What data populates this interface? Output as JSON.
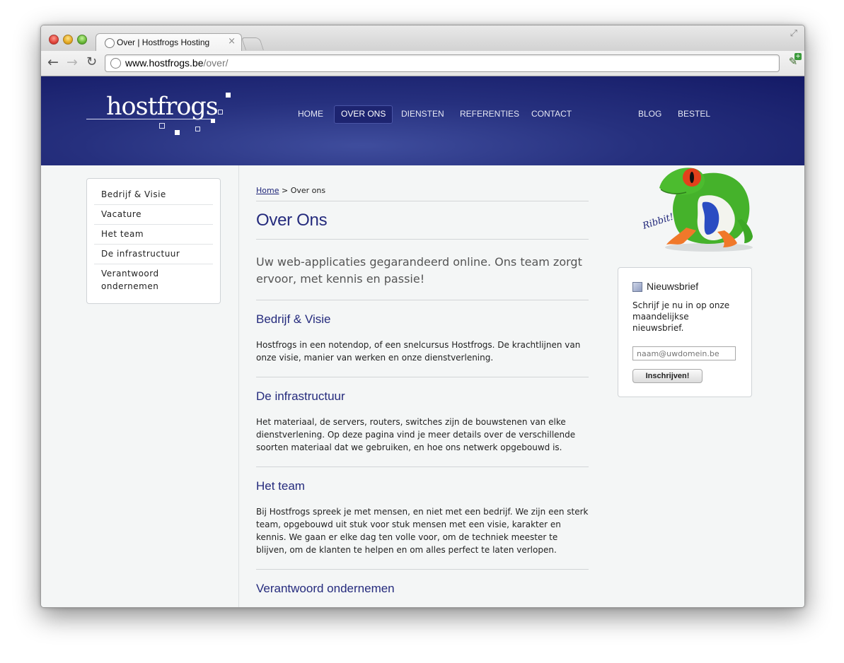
{
  "browser": {
    "tab_title": "Over | Hostfrogs Hosting",
    "tab_close": "×",
    "url_host": "www.hostfrogs.be",
    "url_path": "/over/"
  },
  "header": {
    "logo": "hostfrogs",
    "nav": [
      "HOME",
      "OVER ONS",
      "DIENSTEN",
      "REFERENTIES",
      "CONTACT",
      "BLOG",
      "BESTEL"
    ],
    "active_nav": "OVER ONS"
  },
  "sidebar": {
    "items": [
      "Bedrijf & Visie",
      "Vacature",
      "Het team",
      "De infrastructuur",
      "Verantwoord ondernemen"
    ]
  },
  "main": {
    "breadcrumb_home": "Home",
    "breadcrumb_sep": " > ",
    "breadcrumb_current": "Over ons",
    "title": "Over Ons",
    "intro": "Uw web-applicaties gegarandeerd online. Ons team zorgt ervoor, met kennis en passie!",
    "sections": [
      {
        "heading": "Bedrijf & Visie",
        "text": "Hostfrogs in een notendop, of een snelcursus Hostfrogs. De krachtlijnen van onze visie, manier van werken en onze dienstverlening."
      },
      {
        "heading": "De infrastructuur",
        "text": "Het materiaal, de servers, routers, switches zijn de bouwstenen van elke dienstverlening. Op deze pagina vind je meer details over de verschillende soorten materiaal dat we gebruiken, en hoe ons netwerk opgebouwd is."
      },
      {
        "heading": "Het team",
        "text": "Bij Hostfrogs spreek je met mensen, en niet met een bedrijf. We zijn een sterk team, opgebouwd uit stuk voor stuk mensen met een visie, karakter en kennis. We gaan er elke dag ten volle voor, om de techniek meester te blijven, om de klanten te helpen en om alles perfect te laten verlopen."
      },
      {
        "heading": "Verantwoord ondernemen",
        "text": ""
      }
    ]
  },
  "mascot": {
    "caption": "Ribbit!"
  },
  "newsletter": {
    "title": "Nieuwsbrief",
    "text": "Schrijf je nu in op onze maandelijkse nieuwsbrief.",
    "placeholder": "naam@uwdomein.be",
    "button": "Inschrijven!"
  },
  "colors": {
    "header_bg": "#1a2170",
    "heading": "#252b7d",
    "frog_green": "#43b02a"
  }
}
